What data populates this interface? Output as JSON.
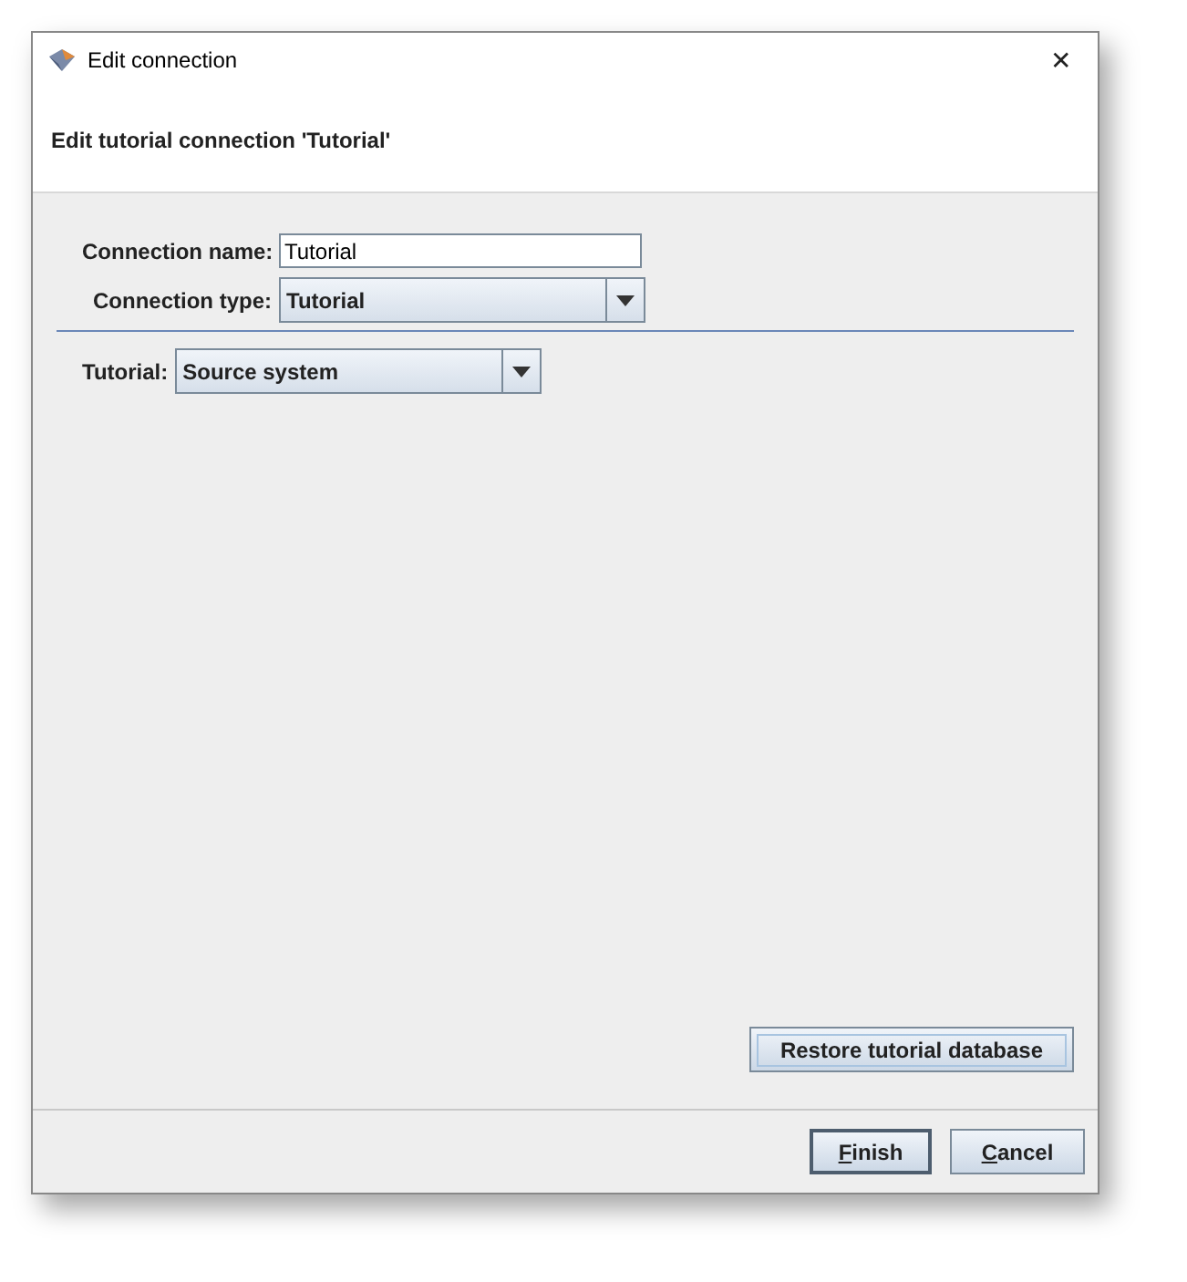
{
  "window": {
    "title": "Edit connection",
    "close": "✕"
  },
  "header": {
    "title": "Edit tutorial connection 'Tutorial'"
  },
  "form": {
    "name_label": "Connection name:",
    "name_value": "Tutorial",
    "type_label": "Connection type:",
    "type_value": "Tutorial"
  },
  "tutorial": {
    "label": "Tutorial:",
    "value": "Source system"
  },
  "restore_button": {
    "label": "Restore tutorial database",
    "focused": true
  },
  "buttons": [
    {
      "mnemonic": "F",
      "rest": "inish",
      "default": true
    },
    {
      "mnemonic": "C",
      "rest": "ancel",
      "default": false
    }
  ]
}
